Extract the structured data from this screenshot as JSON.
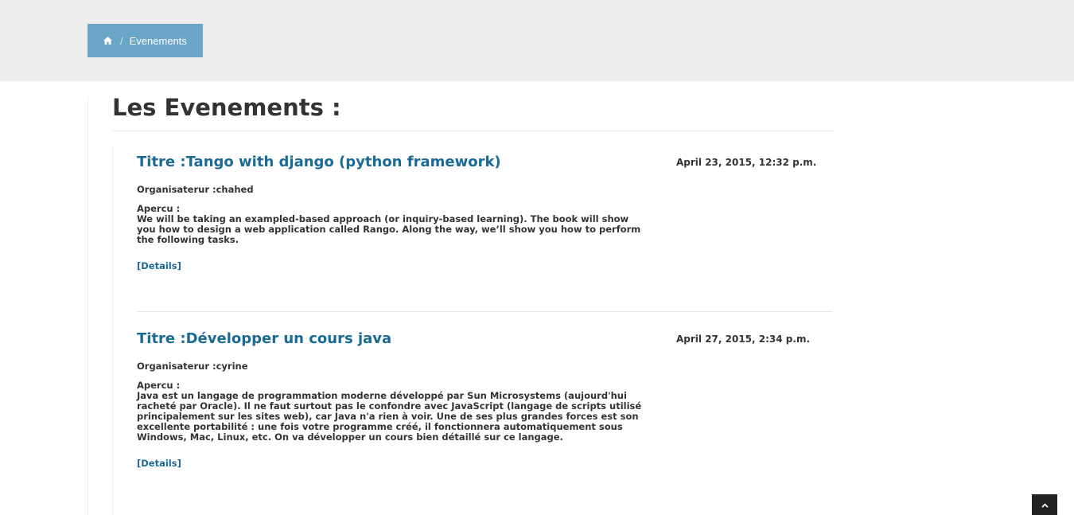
{
  "breadcrumb": {
    "home_icon": "home-icon",
    "separator": "/",
    "current": "Evenements"
  },
  "page": {
    "title": "Les Evenements :"
  },
  "events": [
    {
      "title": "Titre :Tango with django (python framework)",
      "date": "April 23, 2015, 12:32 p.m.",
      "organizer": "Organisaterur :chahed",
      "apercu_label": "Apercu :",
      "apercu": "We will be taking an exampled-based approach (or inquiry-based learning). The book will show you how to design a web application called Rango. Along the way, we’ll show you how to perform the following tasks.",
      "details_label": "[Details]"
    },
    {
      "title": "Titre :Développer un cours java",
      "date": "April 27, 2015, 2:34 p.m.",
      "organizer": "Organisaterur :cyrine",
      "apercu_label": "Apercu :",
      "apercu": "Java est un langage de programmation moderne développé par Sun Microsystems (aujourd'hui racheté par Oracle). Il ne faut surtout pas le confondre avec JavaScript (langage de scripts utilisé principalement sur les sites web), car Java n'a rien à voir. Une de ses plus grandes forces est son excellente portabilité : une fois votre programme créé, il fonctionnera automatiquement sous Windows, Mac, Linux, etc. On va développer un cours bien détaillé sur ce langage.",
      "details_label": "[Details]"
    }
  ],
  "scroll_top": {
    "icon": "chevron-up-icon"
  },
  "colors": {
    "breadcrumb_bg": "#6aa6c8",
    "topbar_bg": "#eeeeee",
    "link": "#1a6a96",
    "text": "#333333"
  }
}
